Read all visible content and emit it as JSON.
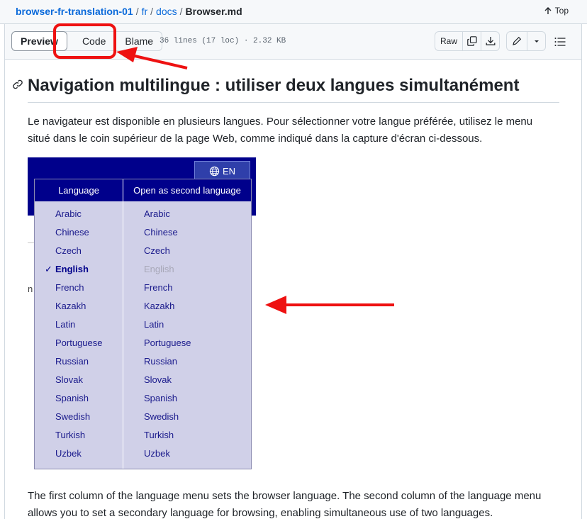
{
  "breadcrumb": {
    "repo": "browser-fr-translation-01",
    "path": [
      "fr",
      "docs"
    ],
    "file": "Browser.md",
    "separator": "/"
  },
  "top_link": {
    "label": "Top",
    "icon": "arrow-up-icon"
  },
  "toolbar": {
    "tabs": {
      "preview": "Preview",
      "code": "Code",
      "blame": "Blame"
    },
    "file_meta": "36 lines (17 loc) · 2.32 KB",
    "raw_label": "Raw",
    "icons": [
      "copy-icon",
      "download-icon",
      "pencil-icon",
      "chevron-down-icon",
      "list-icon"
    ]
  },
  "annotation": {
    "color": "#ee1111"
  },
  "content": {
    "heading": "Navigation multilingue : utiliser deux langues simultanément",
    "paragraph1": "Le navigateur est disponible en plusieurs langues. Pour sélectionner votre langue préférée, utilisez le menu situé dans le coin supérieur de la page Web, comme indiqué dans la capture d'écran ci-dessous.",
    "paragraph2": "The first column of the language menu sets the browser language. The second column of the language menu allows you to set a secondary language for browsing, enabling simultaneous use of two languages."
  },
  "screenshot": {
    "lang_button": "EN",
    "stray_text": "n",
    "menu": {
      "col1_header": "Language",
      "col2_header": "Open as second language",
      "selected_mark": "✓",
      "col1": [
        "Arabic",
        "Chinese",
        "Czech",
        "English",
        "French",
        "Kazakh",
        "Latin",
        "Portuguese",
        "Russian",
        "Slovak",
        "Spanish",
        "Swedish",
        "Turkish",
        "Uzbek"
      ],
      "col2": [
        "Arabic",
        "Chinese",
        "Czech",
        "English",
        "French",
        "Kazakh",
        "Latin",
        "Portuguese",
        "Russian",
        "Slovak",
        "Spanish",
        "Swedish",
        "Turkish",
        "Uzbek"
      ],
      "selected": "English",
      "col2_disabled": "English"
    },
    "colors": {
      "dark_blue": "#00008b",
      "menu_bg": "#d0d0e8",
      "item_text": "#1a1a8c"
    }
  }
}
